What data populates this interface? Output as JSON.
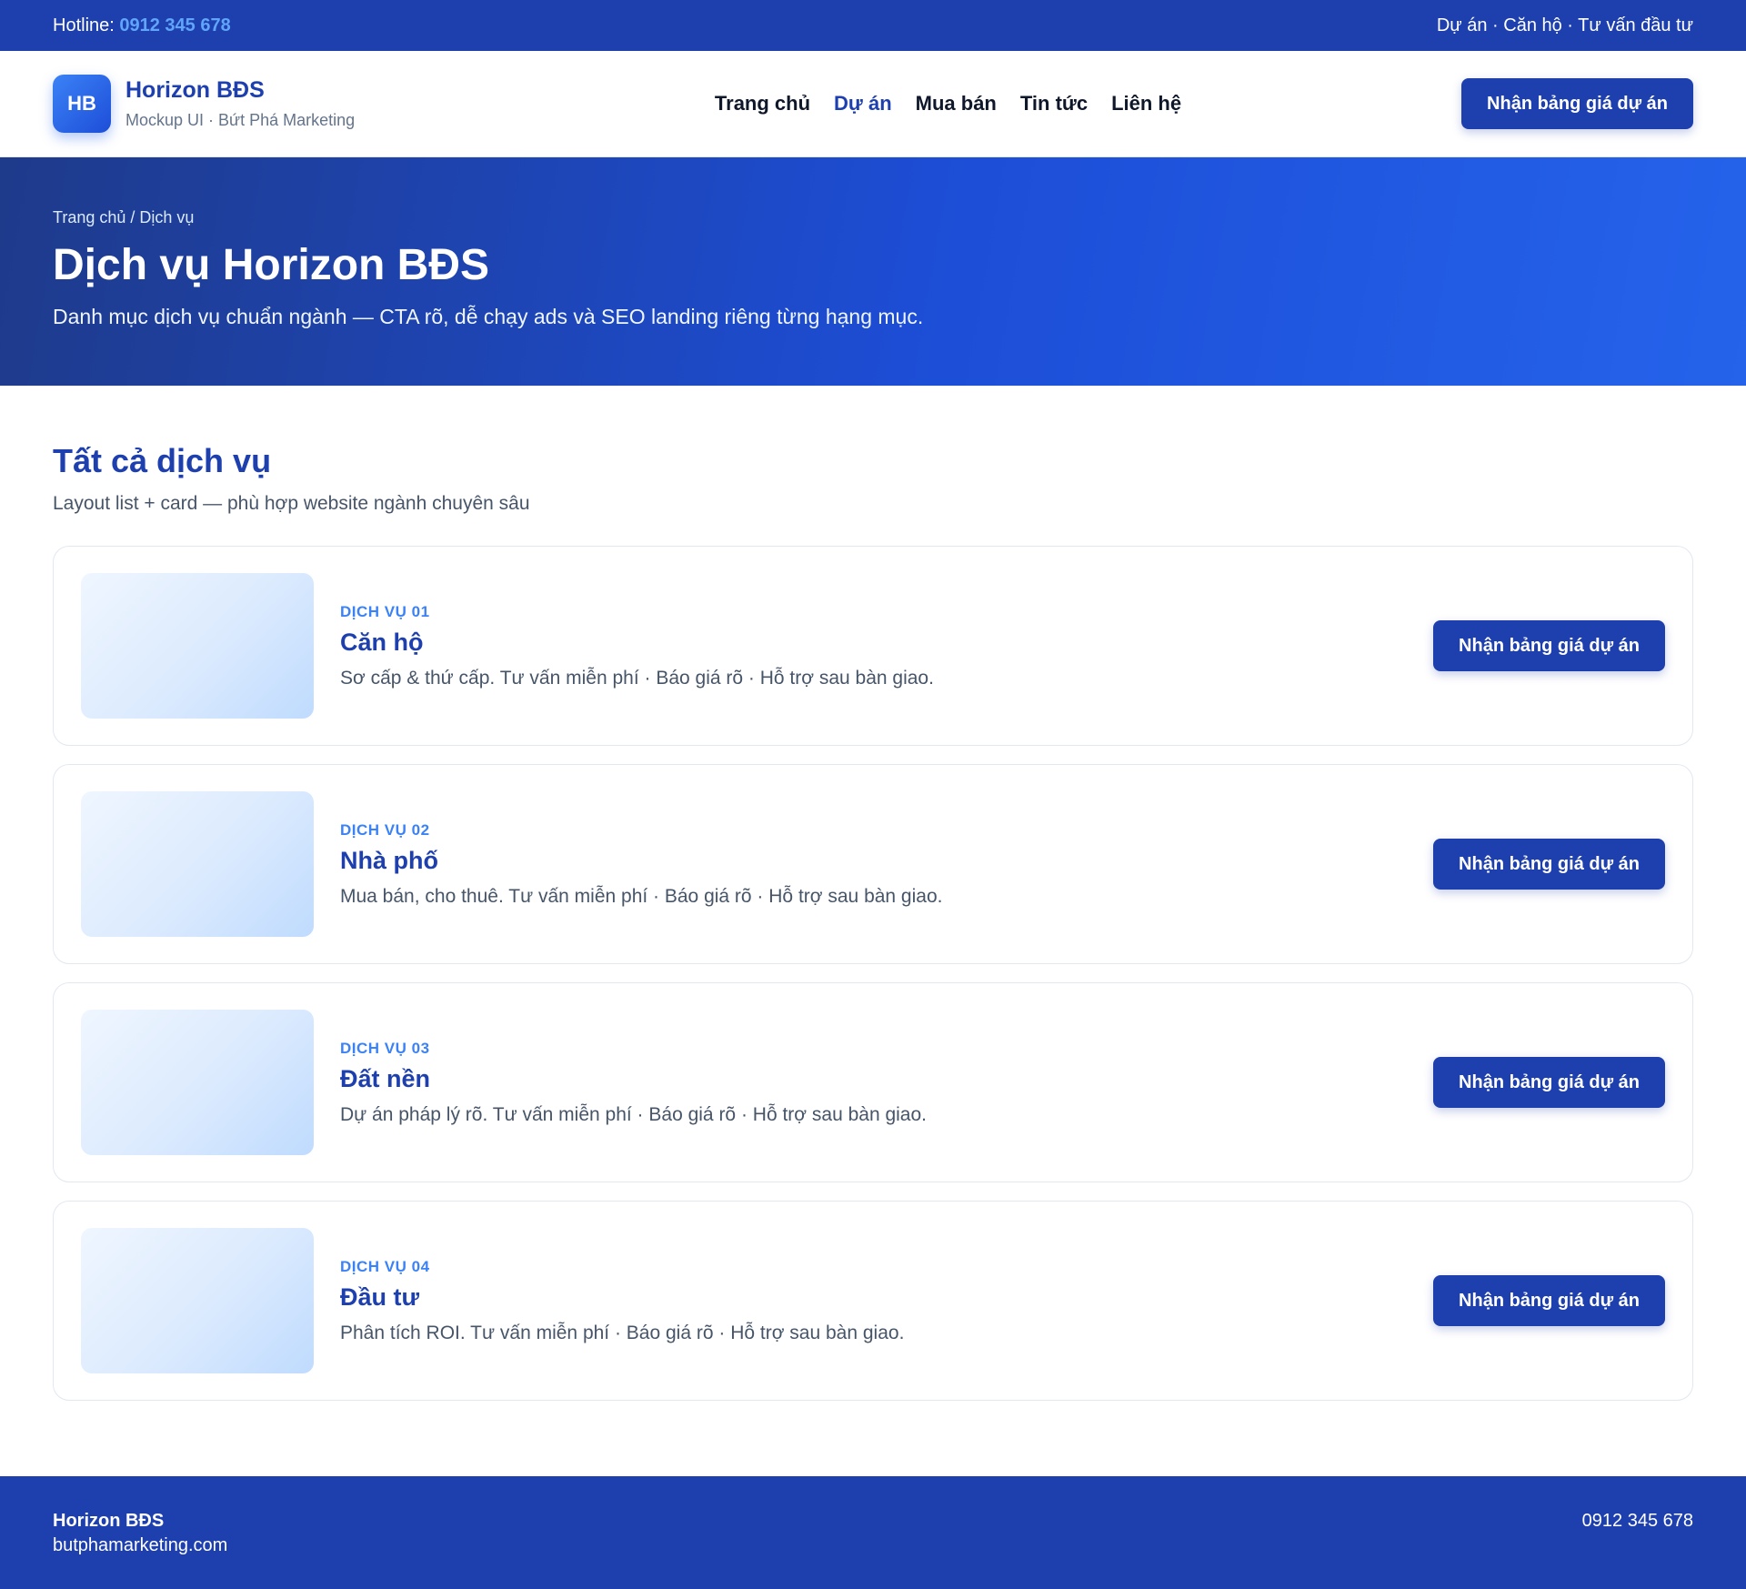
{
  "topbar": {
    "hotline_label": "Hotline: ",
    "hotline_number": "0912 345 678",
    "links_text": "Dự án · Căn hộ · Tư vấn đầu tư"
  },
  "header": {
    "logo_text": "HB",
    "brand_name": "Horizon BĐS",
    "brand_tagline": "Mockup UI · Bứt Phá Marketing",
    "nav": [
      "Trang chủ",
      "Dự án",
      "Mua bán",
      "Tin tức",
      "Liên hệ"
    ],
    "active_nav": "Dự án",
    "cta_label": "Nhận bảng giá dự án"
  },
  "hero": {
    "breadcrumb": "Trang chủ / Dịch vụ",
    "title": "Dịch vụ Horizon BĐS",
    "subtitle": "Danh mục dịch vụ chuẩn ngành — CTA rõ, dễ chạy ads và SEO landing riêng từng hạng mục."
  },
  "services": {
    "title": "Tất cả dịch vụ",
    "subtitle": "Layout list + card — phù hợp website ngành chuyên sâu",
    "items": [
      {
        "label": "DỊCH VỤ 01",
        "title": "Căn hộ",
        "description": "Sơ cấp & thứ cấp. Tư vấn miễn phí · Báo giá rõ · Hỗ trợ sau bàn giao.",
        "cta": "Nhận bảng giá dự án"
      },
      {
        "label": "DỊCH VỤ 02",
        "title": "Nhà phố",
        "description": "Mua bán, cho thuê. Tư vấn miễn phí · Báo giá rõ · Hỗ trợ sau bàn giao.",
        "cta": "Nhận bảng giá dự án"
      },
      {
        "label": "DỊCH VỤ 03",
        "title": "Đất nền",
        "description": "Dự án pháp lý rõ. Tư vấn miễn phí · Báo giá rõ · Hỗ trợ sau bàn giao.",
        "cta": "Nhận bảng giá dự án"
      },
      {
        "label": "DỊCH VỤ 04",
        "title": "Đầu tư",
        "description": "Phân tích ROI. Tư vấn miễn phí · Báo giá rõ · Hỗ trợ sau bàn giao.",
        "cta": "Nhận bảng giá dự án"
      }
    ]
  },
  "footer": {
    "brand": "Horizon BĐS",
    "website": "butphamarketing.com",
    "phone": "0912 345 678"
  },
  "colors": {
    "primary": "#1e40af",
    "accent": "#3b82f6",
    "hotline": "#60a5fa"
  }
}
